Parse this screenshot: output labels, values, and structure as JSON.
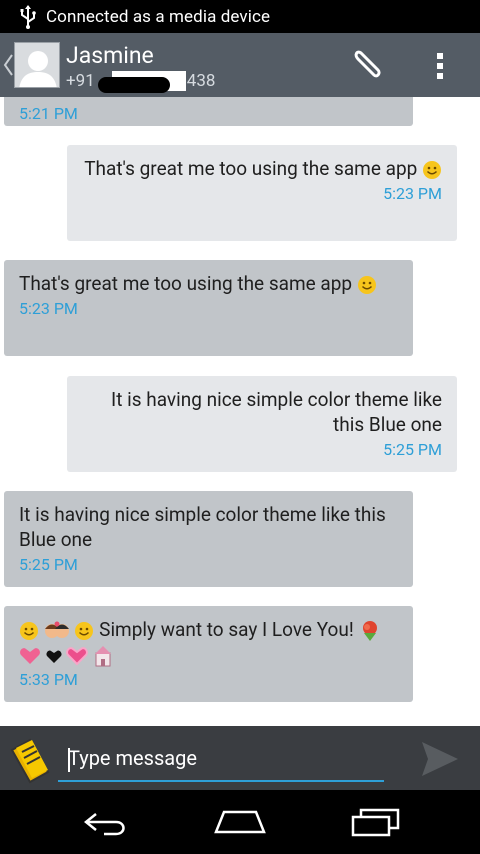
{
  "status_bar": {
    "text": "Connected as a media device"
  },
  "header": {
    "contact_name": "Jasmine",
    "contact_number_prefix": "+91",
    "contact_number_suffix": "438"
  },
  "messages": [
    {
      "direction": "in",
      "text": "",
      "time": "5:21 PM"
    },
    {
      "direction": "out",
      "text": "That's great me too using the same app",
      "time": "5:23 PM"
    },
    {
      "direction": "in",
      "text": "That's great me too using the same app",
      "time": "5:23 PM"
    },
    {
      "direction": "out",
      "text": "It is having nice simple color theme like this Blue one",
      "time": "5:25 PM"
    },
    {
      "direction": "in",
      "text": "It is having nice simple color theme like this Blue one",
      "time": "5:25 PM"
    },
    {
      "direction": "in",
      "text": "Simply want to say I Love You!",
      "time": "5:33 PM"
    }
  ],
  "composer": {
    "placeholder": "Type message"
  },
  "colors": {
    "accent": "#2e9fd7",
    "action_bar": "#545c65",
    "incoming": "#c1c5c9",
    "outgoing": "#e5e7ea"
  },
  "icons": [
    "usb-icon",
    "back-chevron-icon",
    "contact-avatar",
    "paperclip-icon",
    "overflow-menu-icon",
    "note-icon",
    "send-icon",
    "back-nav-icon",
    "home-nav-icon",
    "recents-nav-icon"
  ]
}
